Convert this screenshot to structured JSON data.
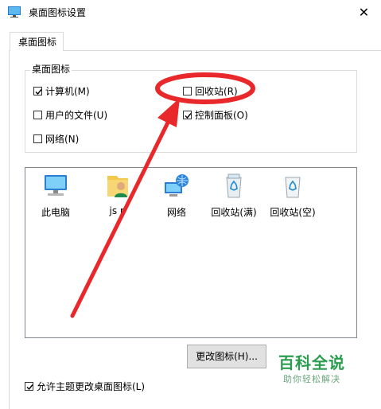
{
  "window": {
    "title": "桌面图标设置",
    "close_label": "✕"
  },
  "tabs": [
    {
      "label": "桌面图标"
    }
  ],
  "group": {
    "label": "桌面图标",
    "checkboxes": [
      {
        "label": "计算机(M)",
        "checked": true
      },
      {
        "label": "回收站(R)",
        "checked": false
      },
      {
        "label": "用户的文件(U)",
        "checked": false
      },
      {
        "label": "控制面板(O)",
        "checked": true
      },
      {
        "label": "网络(N)",
        "checked": false
      }
    ]
  },
  "icons": [
    {
      "label": "此电脑",
      "icon": "computer-icon"
    },
    {
      "label": "js p",
      "icon": "user-folder-icon"
    },
    {
      "label": "网络",
      "icon": "network-icon"
    },
    {
      "label": "回收站(满)",
      "icon": "recycle-bin-full-icon"
    },
    {
      "label": "回收站(空)",
      "icon": "recycle-bin-empty-icon"
    }
  ],
  "buttons": {
    "change_icon": "更改图标(H)..."
  },
  "allow_themes": {
    "label": "允许主题更改桌面图标(L)",
    "checked": true
  },
  "watermark": {
    "title": "百科全说",
    "subtitle": "助你轻松解决"
  },
  "colors": {
    "annotation": "#e8282b",
    "watermark": "#2a9d4f"
  }
}
